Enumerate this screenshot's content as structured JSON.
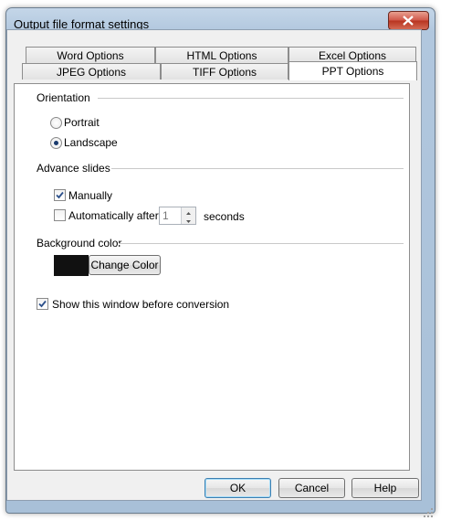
{
  "window": {
    "title": "Output file format settings"
  },
  "tabs": {
    "row_back": [
      "Word Options",
      "HTML Options",
      "Excel Options"
    ],
    "row_front": [
      "JPEG Options",
      "TIFF Options",
      "PPT Options"
    ],
    "active": "PPT Options"
  },
  "orientation": {
    "label": "Orientation",
    "options": [
      "Portrait",
      "Landscape"
    ],
    "selected": "Landscape"
  },
  "advance": {
    "label": "Advance slides",
    "manually_label": "Manually",
    "manually_checked": true,
    "auto_label": "Automatically after",
    "auto_checked": false,
    "seconds_value": "1",
    "seconds_label": "seconds"
  },
  "background": {
    "label": "Background color",
    "swatch_color": "#111111",
    "change_button": "Change Color"
  },
  "show_window": {
    "label": "Show this window before conversion",
    "checked": true
  },
  "buttons": {
    "ok": "OK",
    "cancel": "Cancel",
    "help": "Help"
  }
}
